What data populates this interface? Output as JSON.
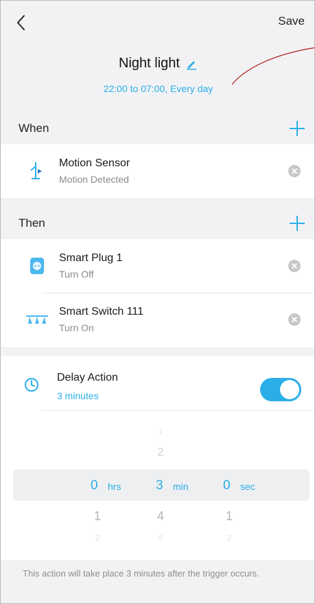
{
  "header": {
    "save_label": "Save",
    "title": "Night light",
    "schedule": "22:00 to 07:00, Every day"
  },
  "when": {
    "label": "When",
    "items": [
      {
        "name": "Motion Sensor",
        "state": "Motion Detected",
        "icon": "motion-sensor-icon"
      }
    ]
  },
  "then": {
    "label": "Then",
    "items": [
      {
        "name": "Smart Plug 1",
        "state": "Turn Off",
        "icon": "smart-plug-icon"
      },
      {
        "name": "Smart Switch 111",
        "state": "Turn On",
        "icon": "smart-switch-icon"
      }
    ]
  },
  "delay": {
    "title": "Delay Action",
    "value": "3 minutes",
    "enabled": true
  },
  "picker": {
    "hours": {
      "above2": "",
      "above1": "",
      "selected": "0",
      "below1": "1",
      "below2": "2",
      "unit": "hrs"
    },
    "minutes": {
      "above2": "1",
      "above1": "2",
      "selected": "3",
      "below1": "4",
      "below2": "5",
      "unit": "min"
    },
    "seconds": {
      "above2": "",
      "above1": "",
      "selected": "0",
      "below1": "1",
      "below2": "2",
      "unit": "sec"
    }
  },
  "footnote": "This action will take place 3 minutes after the trigger occurs.",
  "colors": {
    "accent": "#2aaee8",
    "annotation": "#b01818"
  }
}
